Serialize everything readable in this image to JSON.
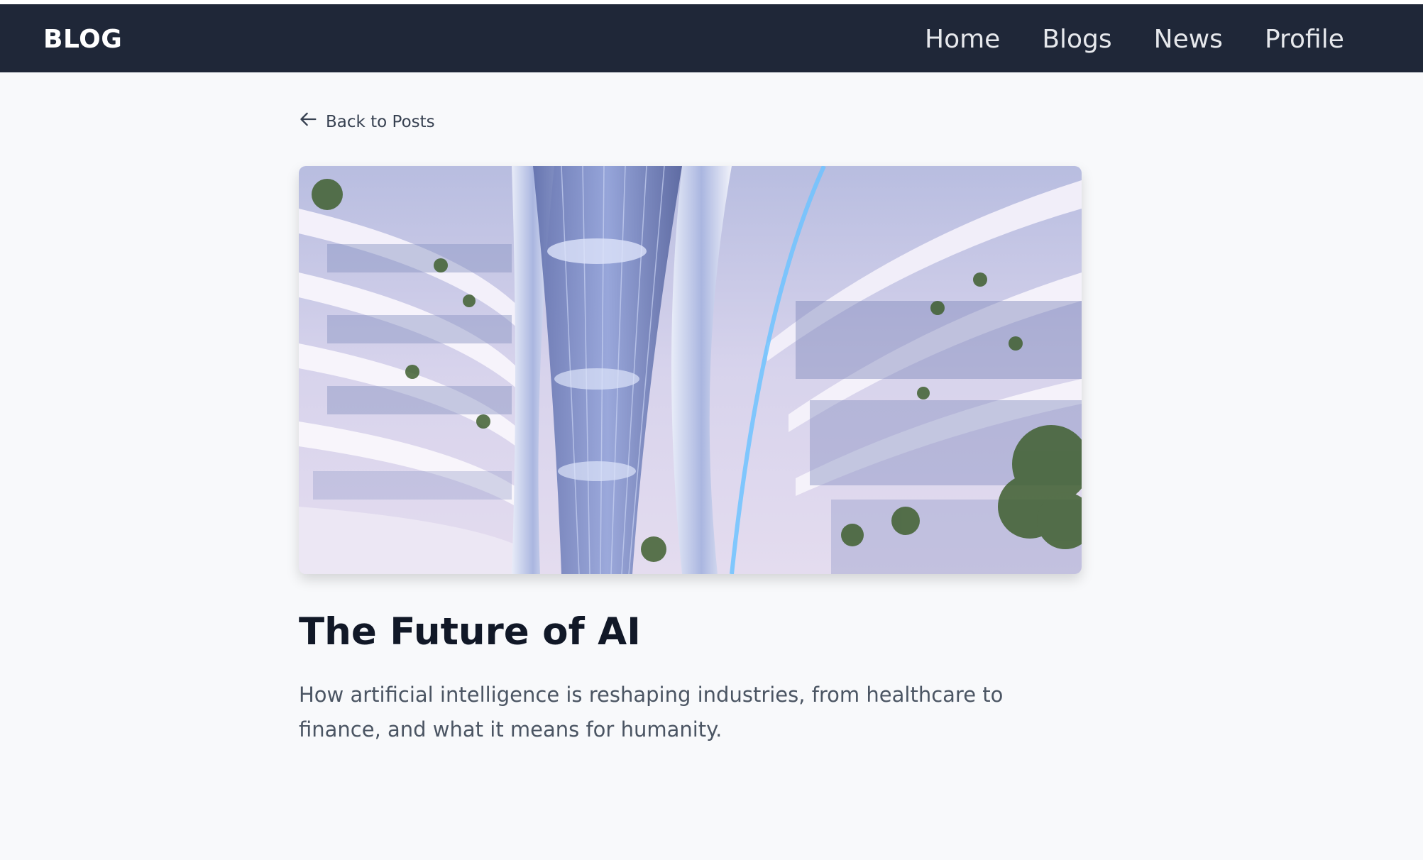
{
  "header": {
    "brand": "BLOG",
    "nav": [
      {
        "label": "Home"
      },
      {
        "label": "Blogs"
      },
      {
        "label": "News"
      },
      {
        "label": "Profile"
      }
    ]
  },
  "post": {
    "back_label": "Back to Posts",
    "title": "The Future of AI",
    "description": "How artificial intelligence is reshaping industries, from healthcare to finance, and what it means for humanity."
  },
  "icons": {
    "back": "arrow-left-icon"
  },
  "colors": {
    "navbar": "#1f2738",
    "page_background": "#f8f9fb",
    "title": "#111827",
    "body_text": "#4b5563"
  }
}
